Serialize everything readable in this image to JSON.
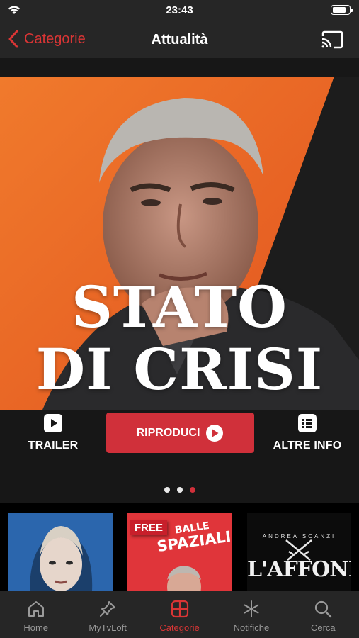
{
  "status_bar": {
    "time": "23:43",
    "battery_level": 0.88
  },
  "nav": {
    "back_label": "Categorie",
    "title": "Attualità"
  },
  "hero": {
    "title_line1": "STATO",
    "title_line2": "DI CRISI",
    "trailer_label": "TRAILER",
    "play_label": "RIPRODUCI",
    "info_label": "ALTRE INFO",
    "page_count": 3,
    "active_page": 3
  },
  "row": {
    "cards": [
      {
        "badge": "",
        "title": ""
      },
      {
        "badge": "FREE",
        "title_line1": "BALLE",
        "title_line2": "SPAZIALI"
      },
      {
        "badge": "",
        "author": "ANDREA SCANZI",
        "title": "L'AFFONDO"
      }
    ]
  },
  "tabs": [
    {
      "label": "Home",
      "icon": "home-icon"
    },
    {
      "label": "MyTvLoft",
      "icon": "pin-icon"
    },
    {
      "label": "Categorie",
      "icon": "grid-icon",
      "active": true
    },
    {
      "label": "Notifiche",
      "icon": "asterisk-icon"
    },
    {
      "label": "Cerca",
      "icon": "search-icon"
    }
  ],
  "colors": {
    "accent": "#d0303a",
    "bar_bg": "#262626",
    "inactive": "#9a9a9a"
  }
}
